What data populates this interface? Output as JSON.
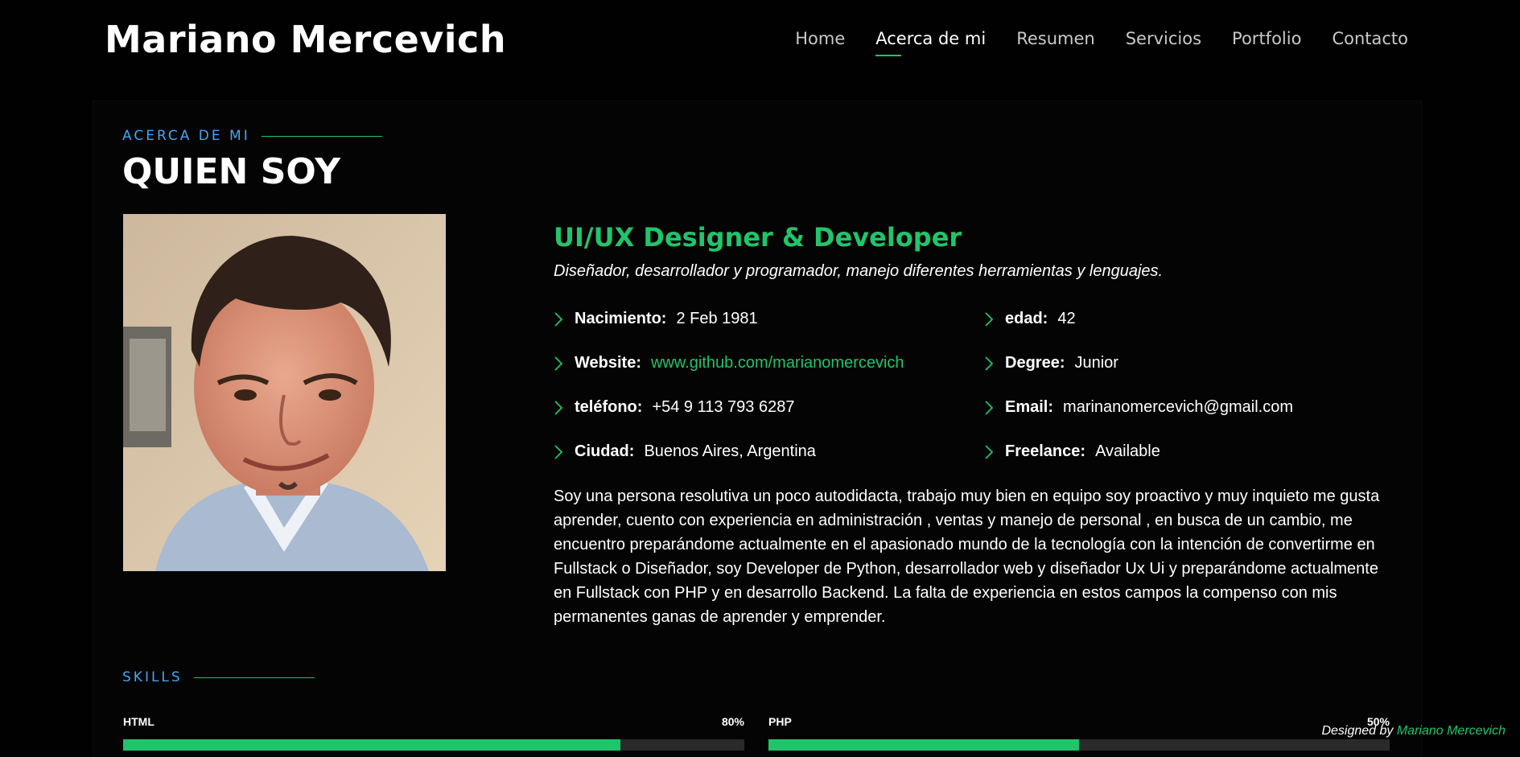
{
  "header": {
    "logo": "Mariano Mercevich",
    "nav": [
      {
        "label": "Home",
        "active": false
      },
      {
        "label": "Acerca de mi",
        "active": true
      },
      {
        "label": "Resumen",
        "active": false
      },
      {
        "label": "Servicios",
        "active": false
      },
      {
        "label": "Portfolio",
        "active": false
      },
      {
        "label": "Contacto",
        "active": false
      }
    ]
  },
  "about": {
    "section_label": "ACERCA DE MI",
    "title": "QUIEN SOY",
    "role": "UI/UX Designer & Developer",
    "tagline": "Diseñador, desarrollador y programador, manejo diferentes herramientas y lenguajes.",
    "facts": [
      {
        "key": "Nacimiento:",
        "value": "2 Feb 1981"
      },
      {
        "key": "edad:",
        "value": "42"
      },
      {
        "key": "Website:",
        "value": "www.github.com/marianomercevich",
        "link": true
      },
      {
        "key": "Degree:",
        "value": "Junior"
      },
      {
        "key": "teléfono:",
        "value": "+54 9 113 793 6287"
      },
      {
        "key": "Email:",
        "value": "marinanomercevich@gmail.com"
      },
      {
        "key": "Ciudad:",
        "value": "Buenos Aires, Argentina"
      },
      {
        "key": "Freelance:",
        "value": "Available"
      }
    ],
    "bio": "Soy una persona resolutiva un poco autodidacta, trabajo muy bien en equipo soy proactivo y muy inquieto me gusta aprender, cuento con experiencia en administración , ventas y manejo de personal , en busca de un cambio, me encuentro preparándome actualmente en el apasionado mundo de la tecnología con la intención de convertirme en Fullstack o Diseñador, soy Developer de Python, desarrollador web y diseñador Ux Ui y preparándome actualmente en Fullstack con PHP y en desarrollo Backend. La falta de experiencia en estos campos la compenso con mis permanentes ganas de aprender y emprender."
  },
  "skills": {
    "label": "SKILLS",
    "items": [
      {
        "name": "HTML",
        "percent_label": "80%",
        "percent": 80
      },
      {
        "name": "PHP",
        "percent_label": "50%",
        "percent": 50
      }
    ]
  },
  "credits": {
    "prefix": "Designed by",
    "author": "Mariano Mercevich"
  },
  "colors": {
    "accent": "#21c46a",
    "label_blue": "#4aa3f0",
    "background": "#010101"
  }
}
